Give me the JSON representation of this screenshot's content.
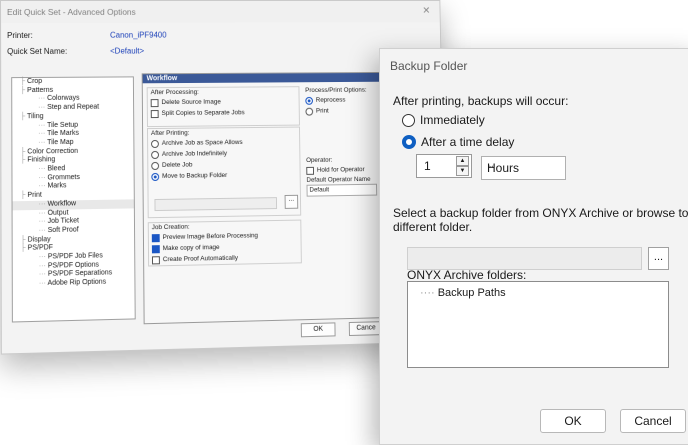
{
  "background_window": {
    "title": "Edit Quick Set - Advanced Options",
    "printer_label": "Printer:",
    "printer_value": "Canon_iPF9400",
    "quickset_label": "Quick Set Name:",
    "quickset_value": "<Default>",
    "tree": [
      {
        "label": "Crop",
        "level": 0
      },
      {
        "label": "Patterns",
        "level": 0
      },
      {
        "label": "Colorways",
        "level": 1
      },
      {
        "label": "Step and Repeat",
        "level": 1
      },
      {
        "label": "Tiling",
        "level": 0
      },
      {
        "label": "Tile Setup",
        "level": 1
      },
      {
        "label": "Tile Marks",
        "level": 1
      },
      {
        "label": "Tile Map",
        "level": 1
      },
      {
        "label": "Color Correction",
        "level": 0
      },
      {
        "label": "Finishing",
        "level": 0
      },
      {
        "label": "Bleed",
        "level": 1
      },
      {
        "label": "Grommets",
        "level": 1
      },
      {
        "label": "Marks",
        "level": 1
      },
      {
        "label": "Print",
        "level": 0
      },
      {
        "label": "Workflow",
        "level": 1
      },
      {
        "label": "Output",
        "level": 1
      },
      {
        "label": "Job Ticket",
        "level": 1
      },
      {
        "label": "Soft Proof",
        "level": 1
      },
      {
        "label": "Display",
        "level": 0
      },
      {
        "label": "PS/PDF",
        "level": 0
      },
      {
        "label": "PS/PDF Job Files",
        "level": 1
      },
      {
        "label": "PS/PDF Options",
        "level": 1
      },
      {
        "label": "PS/PDF Separations",
        "level": 1
      },
      {
        "label": "Adobe Rip Options",
        "level": 1
      }
    ],
    "workflow": {
      "header": "Workflow",
      "after_processing": {
        "label": "After Processing:",
        "options": [
          "Delete Source Image",
          "Split Copies to Separate Jobs"
        ]
      },
      "after_printing": {
        "label": "After Printing:",
        "options": [
          "Archive Job as Space Allows",
          "Archive Job Indefinitely",
          "Delete Job",
          "Move to Backup Folder"
        ],
        "selected": "Move to Backup Folder"
      },
      "browse_label": "...",
      "process_print": {
        "label": "Process/Print Options:",
        "options": [
          "Reprocess",
          "Print"
        ],
        "selected": "Reprocess"
      },
      "operator": {
        "label": "Operator:",
        "hold_label": "Hold for Operator",
        "default_name_label": "Default Operator Name",
        "default_name_value": "Default"
      },
      "job_creation": {
        "label": "Job Creation:",
        "options": [
          {
            "label": "Preview Image Before Processing",
            "checked": true
          },
          {
            "label": "Make copy of image",
            "checked": true
          },
          {
            "label": "Create Proof Automatically",
            "checked": false
          }
        ]
      }
    },
    "ok_label": "OK",
    "cancel_label": "Cance"
  },
  "dialog": {
    "title": "Backup Folder",
    "close_icon": "close-icon",
    "after_printing_text": "After printing, backups will occur:",
    "radio_immediately": "Immediately",
    "radio_delay": "After a time delay",
    "selected": "After a time delay",
    "delay_value": "1",
    "delay_unit": "Hours",
    "select_text_line1": "Select a backup folder from ONYX Archive or browse to a",
    "select_text_line2": "different folder.",
    "path_value": "",
    "browse_label": "...",
    "archive_label": "ONYX Archive folders:",
    "archive_items": [
      "Backup Paths"
    ],
    "ok_label": "OK",
    "cancel_label": "Cancel"
  },
  "colors": {
    "accent": "#0f5fc2",
    "header": "#3b5998"
  }
}
